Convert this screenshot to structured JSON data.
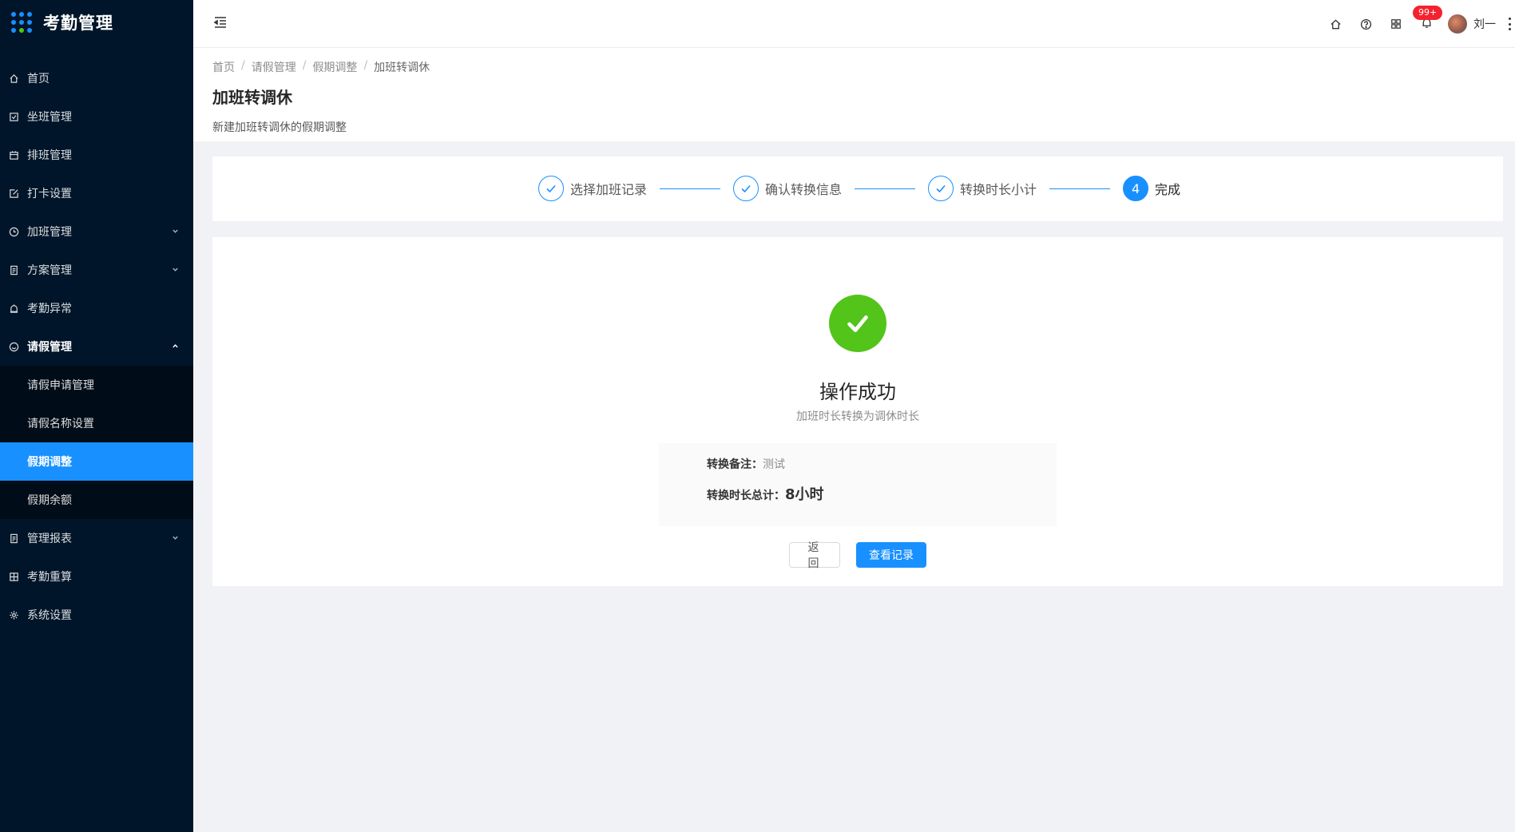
{
  "app": {
    "title": "考勤管理"
  },
  "sidebar": {
    "items": [
      {
        "label": "首页",
        "icon": "home-icon"
      },
      {
        "label": "坐班管理",
        "icon": "calendar-check-icon"
      },
      {
        "label": "排班管理",
        "icon": "schedule-icon"
      },
      {
        "label": "打卡设置",
        "icon": "edit-icon"
      },
      {
        "label": "加班管理",
        "icon": "clock-icon",
        "expandable": true
      },
      {
        "label": "方案管理",
        "icon": "file-icon",
        "expandable": true
      },
      {
        "label": "考勤异常",
        "icon": "alarm-icon"
      },
      {
        "label": "请假管理",
        "icon": "smile-icon",
        "expanded": true
      }
    ],
    "leave_submenu": [
      {
        "label": "请假申请管理"
      },
      {
        "label": "请假名称设置"
      },
      {
        "label": "假期调整",
        "active": true
      },
      {
        "label": "假期余额"
      }
    ],
    "items_after": [
      {
        "label": "管理报表",
        "icon": "report-icon",
        "expandable": true
      },
      {
        "label": "考勤重算",
        "icon": "calculator-icon"
      },
      {
        "label": "系统设置",
        "icon": "gear-icon"
      }
    ]
  },
  "header": {
    "notification_badge": "99+",
    "user_name": "刘一"
  },
  "breadcrumb": [
    "首页",
    "请假管理",
    "假期调整",
    "加班转调休"
  ],
  "page": {
    "title": "加班转调休",
    "description": "新建加班转调休的假期调整"
  },
  "steps": [
    {
      "title": "选择加班记录",
      "status": "finished"
    },
    {
      "title": "确认转换信息",
      "status": "finished"
    },
    {
      "title": "转换时长小计",
      "status": "finished"
    },
    {
      "title": "完成",
      "status": "current",
      "number": "4"
    }
  ],
  "result": {
    "title": "操作成功",
    "subtitle": "加班时长转换为调休时长",
    "remark_label": "转换备注：",
    "remark_value": "测试",
    "total_label": "转换时长总计：",
    "total_value": "8小时"
  },
  "buttons": {
    "back": "返回",
    "view_records": "查看记录"
  },
  "colors": {
    "primary": "#1890ff",
    "success": "#52c41a",
    "sidebar_bg": "#001529",
    "badge": "#f5222d"
  }
}
